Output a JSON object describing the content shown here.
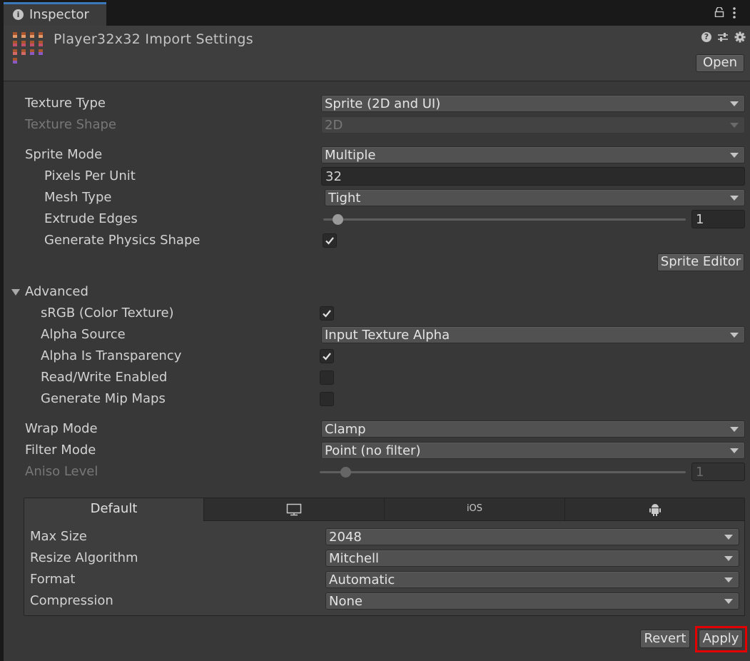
{
  "tab": {
    "label": "Inspector",
    "icon": "info-icon"
  },
  "header": {
    "title": "Player32x32 Import Settings",
    "open_label": "Open",
    "icons": [
      "help-icon",
      "preset-icon",
      "gear-icon"
    ]
  },
  "general": {
    "texture_type": {
      "label": "Texture Type",
      "value": "Sprite (2D and UI)"
    },
    "texture_shape": {
      "label": "Texture Shape",
      "value": "2D"
    },
    "sprite_mode": {
      "label": "Sprite Mode",
      "value": "Multiple"
    },
    "pixels_per_unit": {
      "label": "Pixels Per Unit",
      "value": "32"
    },
    "mesh_type": {
      "label": "Mesh Type",
      "value": "Tight"
    },
    "extrude_edges": {
      "label": "Extrude Edges",
      "value": "1",
      "slider_fraction": 0.04
    },
    "generate_physics_shape": {
      "label": "Generate Physics Shape",
      "checked": true
    },
    "sprite_editor_label": "Sprite Editor"
  },
  "advanced": {
    "label": "Advanced",
    "srgb": {
      "label": "sRGB (Color Texture)",
      "checked": true
    },
    "alpha_source": {
      "label": "Alpha Source",
      "value": "Input Texture Alpha"
    },
    "alpha_is_transparency": {
      "label": "Alpha Is Transparency",
      "checked": true
    },
    "read_write": {
      "label": "Read/Write Enabled",
      "checked": false
    },
    "mip_maps": {
      "label": "Generate Mip Maps",
      "checked": false
    }
  },
  "wrap_mode": {
    "label": "Wrap Mode",
    "value": "Clamp"
  },
  "filter_mode": {
    "label": "Filter Mode",
    "value": "Point (no filter)"
  },
  "aniso_level": {
    "label": "Aniso Level",
    "value": "1",
    "slider_fraction": 0.07
  },
  "platform": {
    "tabs": [
      {
        "label": "Default",
        "icon": ""
      },
      {
        "label": "",
        "icon": "monitor-icon"
      },
      {
        "label": "iOS",
        "icon": ""
      },
      {
        "label": "",
        "icon": "android-icon"
      }
    ],
    "max_size": {
      "label": "Max Size",
      "value": "2048"
    },
    "resize_algorithm": {
      "label": "Resize Algorithm",
      "value": "Mitchell"
    },
    "format": {
      "label": "Format",
      "value": "Automatic"
    },
    "compression": {
      "label": "Compression",
      "value": "None"
    }
  },
  "footer": {
    "revert_label": "Revert",
    "apply_label": "Apply"
  },
  "colors": {
    "highlight": "#e30000",
    "tab_accent": "#3a79bb"
  }
}
